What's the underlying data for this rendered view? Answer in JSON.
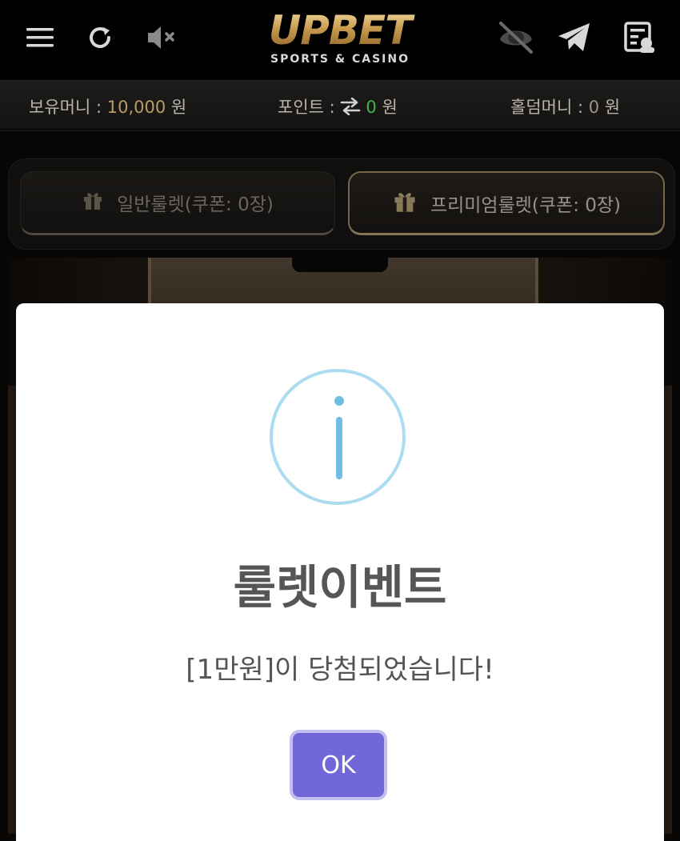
{
  "header": {
    "logo_main": "UPBET",
    "logo_sub": "SPORTS & CASINO",
    "icons": [
      "menu-icon",
      "refresh-icon",
      "mute-icon",
      "hide-icon",
      "telegram-icon",
      "notice-icon"
    ]
  },
  "infobar": {
    "money_label": "보유머니 : ",
    "money_value": "10,000",
    "money_unit": " 원",
    "point_label": "포인트 : ",
    "point_value": "0",
    "point_unit": " 원",
    "holdem_label": "홀덤머니 : ",
    "holdem_value": "0",
    "holdem_unit": " 원"
  },
  "tabs": {
    "normal": "일반룰렛(쿠폰: 0장)",
    "premium": "프리미엄룰렛(쿠폰: 0장)"
  },
  "modal": {
    "title": "룰렛이벤트",
    "message": "[1만원]이 당첨되었습니다!",
    "ok_label": "OK"
  },
  "colors": {
    "gold": "#b89c68",
    "green": "#42b54a",
    "ok_button": "#7267d8",
    "info_icon": "#6cbde3"
  }
}
